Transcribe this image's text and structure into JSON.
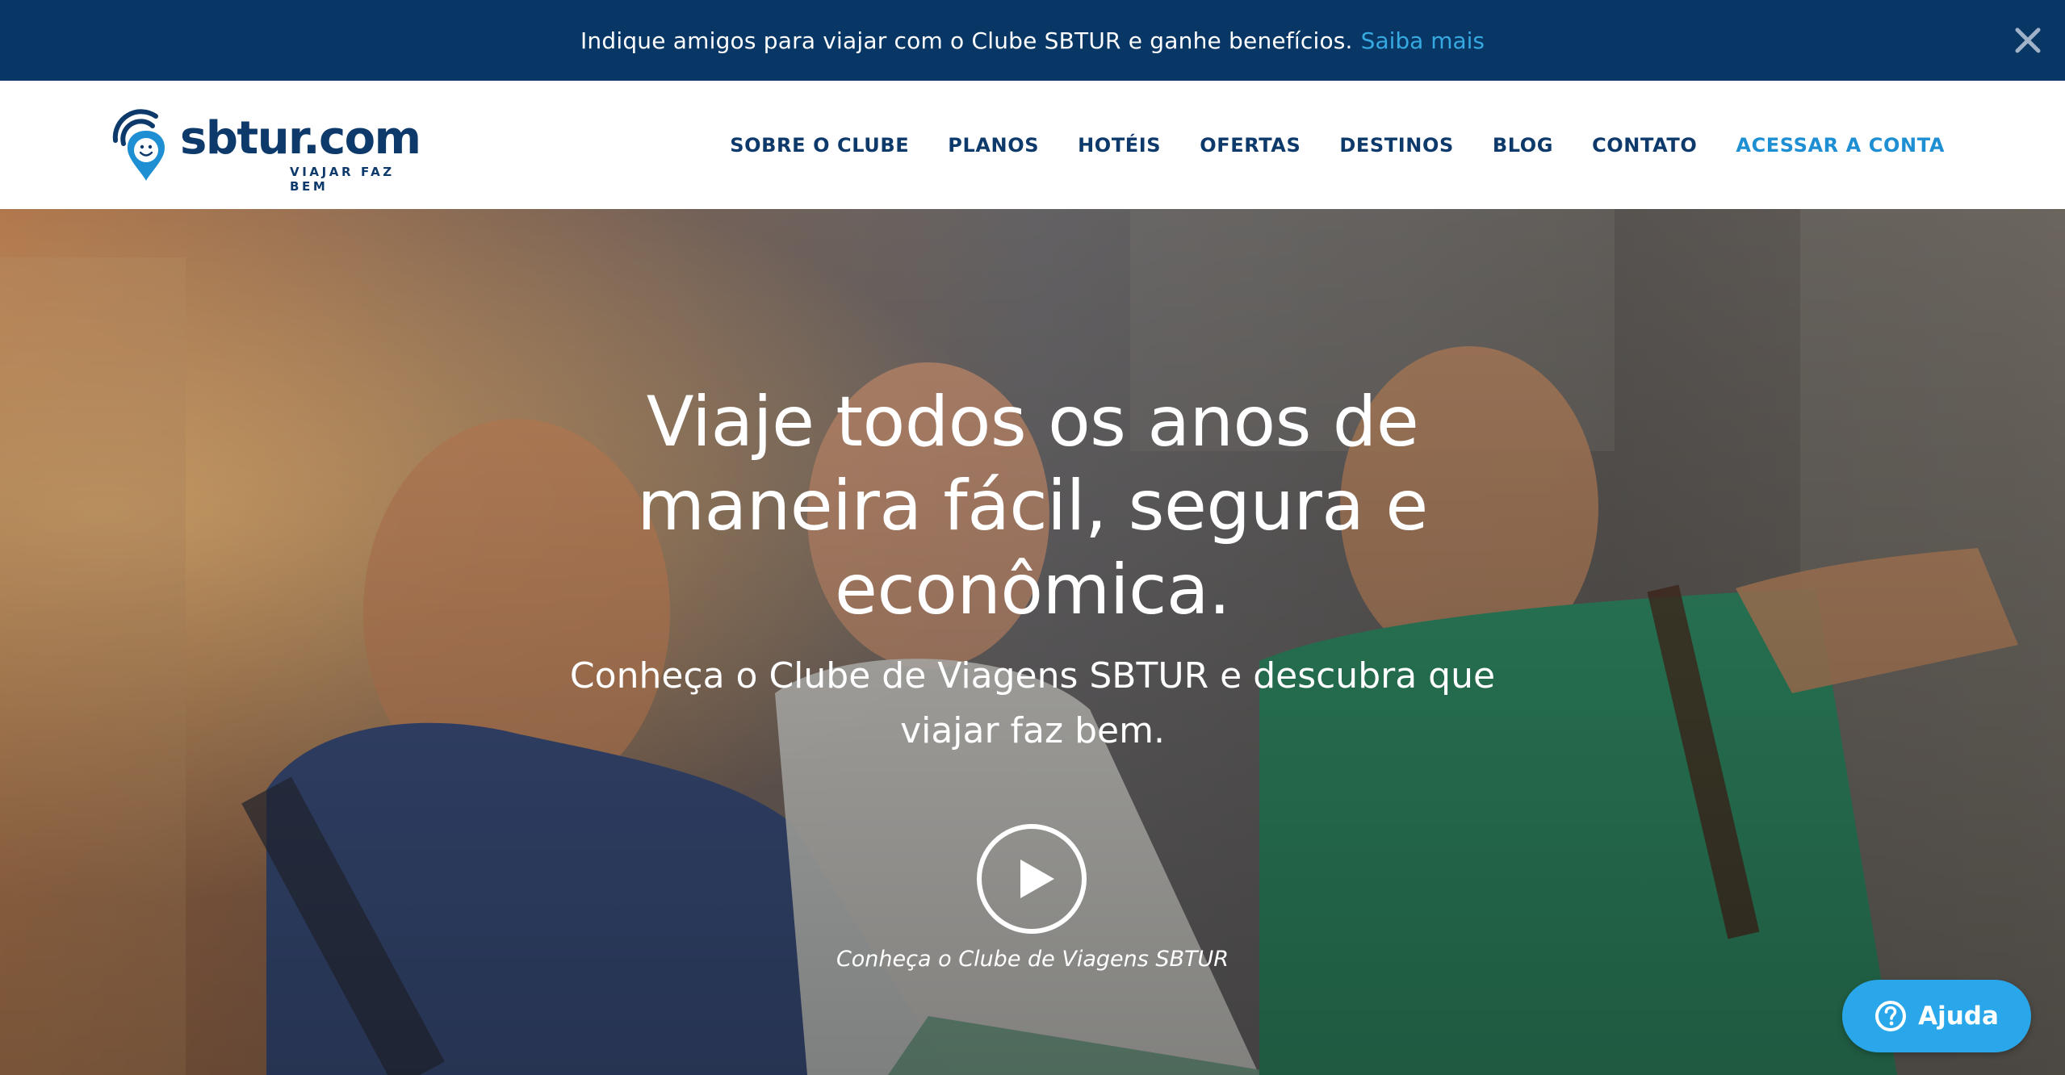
{
  "colors": {
    "promo_bg": "#083766",
    "brand_navy": "#0d3a6b",
    "accent_blue": "#1f8fd3",
    "link_blue": "#36a9e1",
    "help_bg": "#2aa7ea"
  },
  "promo": {
    "text": "Indique amigos para viajar com o Clube SBTUR e ganhe benefícios.",
    "link": "Saiba mais",
    "close_icon": "close-icon"
  },
  "brand": {
    "name": "sbtur.com",
    "tagline": "VIAJAR FAZ BEM"
  },
  "nav": {
    "items": [
      {
        "label": "SOBRE O CLUBE"
      },
      {
        "label": "PLANOS"
      },
      {
        "label": "HOTÉIS"
      },
      {
        "label": "OFERTAS"
      },
      {
        "label": "DESTINOS"
      },
      {
        "label": "BLOG"
      },
      {
        "label": "CONTATO"
      },
      {
        "label": "ACESSAR A CONTA"
      }
    ]
  },
  "hero": {
    "title_lines": [
      "Viaje todos os anos de",
      "maneira fácil, segura e",
      "econômica."
    ],
    "subtitle_lines": [
      "Conheça o Clube de Viagens SBTUR e descubra que",
      "viajar faz bem."
    ],
    "play_icon": "play-icon",
    "video_caption": "Conheça o Clube de Viagens SBTUR"
  },
  "help": {
    "label": "Ajuda",
    "icon": "question-icon"
  }
}
